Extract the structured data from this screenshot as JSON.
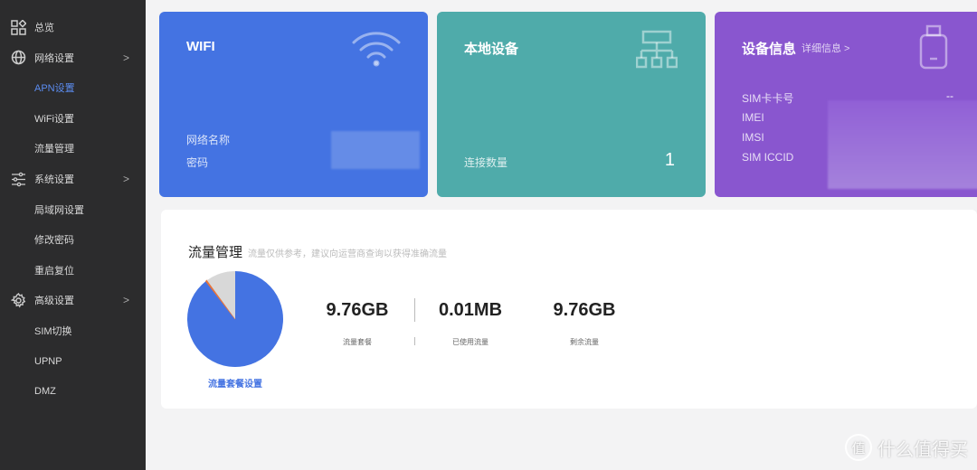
{
  "sidebar": {
    "items": [
      {
        "label": "总览",
        "icon": "grid-icon"
      },
      {
        "label": "网络设置",
        "icon": "globe-icon",
        "expandable": true
      },
      {
        "label": "APN设置",
        "active": true
      },
      {
        "label": "WiFi设置"
      },
      {
        "label": "流量管理"
      },
      {
        "label": "系统设置",
        "icon": "sliders-icon",
        "expandable": true
      },
      {
        "label": "局域网设置"
      },
      {
        "label": "修改密码"
      },
      {
        "label": "重启复位"
      },
      {
        "label": "高级设置",
        "icon": "gear-icon",
        "expandable": true
      },
      {
        "label": "SIM切换"
      },
      {
        "label": "UPNP"
      },
      {
        "label": "DMZ"
      }
    ],
    "chevron": ">"
  },
  "wifi_card": {
    "title": "WIFI",
    "network_name_label": "网络名称",
    "password_label": "密码",
    "color": "#4473e2"
  },
  "device_card": {
    "title": "本地设备",
    "connections_label": "连接数量",
    "connections": "1",
    "color": "#4fabaa"
  },
  "info_card": {
    "title": "设备信息",
    "details_link": "详细信息 >",
    "sim_label": "SIM卡卡号",
    "sim_value": "--",
    "imei_label": "IMEI",
    "imsi_label": "IMSI",
    "iccid_label": "SIM ICCID",
    "color": "#8956cf"
  },
  "traffic": {
    "title": "流量管理",
    "note": "流量仅供参考，建议向运营商查询以获得准确流量",
    "plan_value": "9.76GB",
    "plan_label": "流量套餐",
    "used_value": "0.01MB",
    "used_label": "已使用流量",
    "remain_value": "9.76GB",
    "remain_label": "剩余流量",
    "settings_link": "流量套餐设置",
    "pie": {
      "slices": [
        {
          "fraction": 0.895,
          "color": "#4473e2"
        },
        {
          "fraction": 0.005,
          "color": "#e8743b"
        },
        {
          "fraction": 0.1,
          "color": "#d8d8d8"
        }
      ]
    }
  },
  "watermark": {
    "text": "什么值得买",
    "logo": "值"
  }
}
